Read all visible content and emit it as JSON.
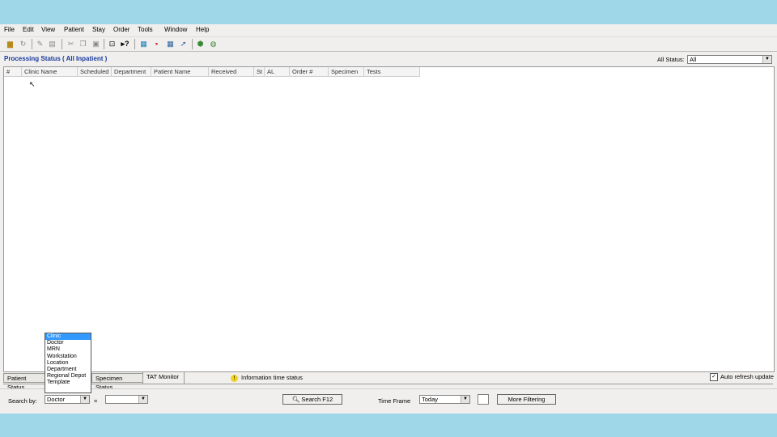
{
  "menu": [
    "File",
    "Edit",
    "View",
    "Patient",
    "Stay",
    "Order",
    "Tools",
    "Window",
    "Help"
  ],
  "toolbar_icons": [
    "open-folder-icon",
    "refresh-icon",
    "edit-icon",
    "print-icon",
    "cut-icon",
    "copy-icon",
    "paste-icon",
    "find-icon",
    "help-icon",
    "patient-icon",
    "order-icon",
    "grid-icon",
    "chart-icon",
    "export-icon",
    "globe-icon"
  ],
  "caption": "Processing Status ( All Inpatient )",
  "all_status": {
    "label": "All Status:",
    "value": "All"
  },
  "columns": [
    "#",
    "Clinic Name",
    "Scheduled",
    "Department",
    "Patient Name",
    "Received",
    "St",
    "AL",
    "Order #",
    "Specimen",
    "Tests"
  ],
  "tabs": [
    "Patient Status",
    "Specimen Status",
    "TAT Monitor"
  ],
  "info_text": "Information time status",
  "auto_refresh": "Auto refresh update",
  "search": {
    "label": "Search by:",
    "value": "Doctor",
    "operator": "=",
    "button": "Search F12",
    "options": [
      "Clinic",
      "Doctor",
      "MRN",
      "Workstation",
      "Location",
      "Department",
      "Regional Depot",
      "Template"
    ]
  },
  "timeframe": {
    "label": "Time Frame",
    "value": "Today",
    "more_button": "More Filtering"
  }
}
